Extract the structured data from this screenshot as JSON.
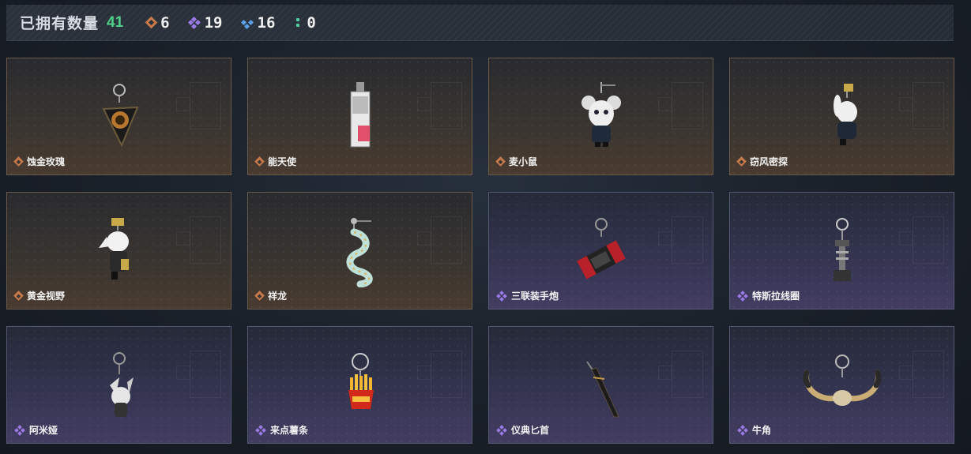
{
  "header": {
    "title": "已拥有数量",
    "total": "41",
    "stats": [
      {
        "icon": "gold-diamond-icon",
        "color": "#c97a4a",
        "count": "6"
      },
      {
        "icon": "purple-quad-diamond-icon",
        "color": "#9a7be6",
        "count": "19"
      },
      {
        "icon": "blue-triple-diamond-icon",
        "color": "#5aa0e8",
        "count": "16"
      },
      {
        "icon": "green-dots-icon",
        "color": "#4fd0a0",
        "count": "0"
      }
    ]
  },
  "items": [
    {
      "name": "蚀金玫瑰",
      "rarity": "gold",
      "icon": "rose-charm-icon"
    },
    {
      "name": "能天使",
      "rarity": "gold",
      "icon": "card-charm-icon"
    },
    {
      "name": "麦小鼠",
      "rarity": "gold",
      "icon": "mouse-charm-icon"
    },
    {
      "name": "窃风密探",
      "rarity": "gold",
      "icon": "rabbit-charm-icon"
    },
    {
      "name": "黄金视野",
      "rarity": "gold",
      "icon": "figure-charm-icon"
    },
    {
      "name": "祥龙",
      "rarity": "gold",
      "icon": "dragon-charm-icon"
    },
    {
      "name": "三联装手炮",
      "rarity": "purple",
      "icon": "cannon-charm-icon"
    },
    {
      "name": "特斯拉线圈",
      "rarity": "purple",
      "icon": "coil-charm-icon"
    },
    {
      "name": "阿米娅",
      "rarity": "purple",
      "icon": "bunny-charm-icon"
    },
    {
      "name": "来点薯条",
      "rarity": "purple",
      "icon": "fries-charm-icon"
    },
    {
      "name": "仪典匕首",
      "rarity": "purple",
      "icon": "dagger-charm-icon"
    },
    {
      "name": "牛角",
      "rarity": "purple",
      "icon": "horns-charm-icon"
    }
  ]
}
